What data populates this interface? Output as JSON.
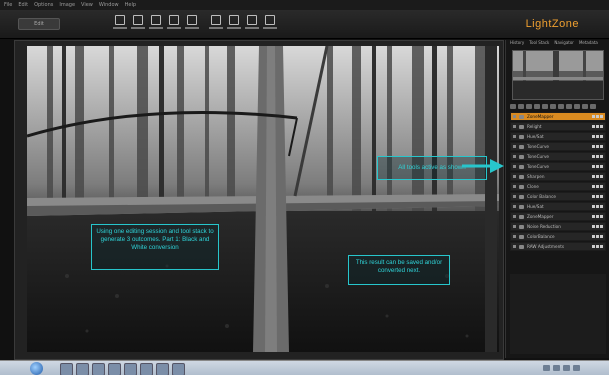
{
  "app": {
    "brand": "LightZone",
    "logo_label": "Edit"
  },
  "menu": [
    "File",
    "Edit",
    "Options",
    "Image",
    "View",
    "Window",
    "Help"
  ],
  "toolbar": {
    "buttons": [
      "",
      "",
      "",
      "",
      "",
      "",
      "",
      "",
      ""
    ]
  },
  "panel": {
    "tabs": [
      "History",
      "Tool Stack",
      "Navigator",
      "Metadata"
    ],
    "tools": [
      {
        "label": "ZoneMapper",
        "active": true
      },
      {
        "label": "Relight",
        "active": false
      },
      {
        "label": "Hue/Sat",
        "active": false
      },
      {
        "label": "ToneCurve",
        "active": false
      },
      {
        "label": "ToneCurve",
        "active": false
      },
      {
        "label": "ToneCurve",
        "active": false
      },
      {
        "label": "Sharpen",
        "active": false
      },
      {
        "label": "Clone",
        "active": false
      },
      {
        "label": "Color Balance",
        "active": false
      },
      {
        "label": "Hue/Sat",
        "active": false
      },
      {
        "label": "ZoneMapper",
        "active": false
      },
      {
        "label": "Noise Reduction",
        "active": false
      },
      {
        "label": "ColorBalance",
        "active": false
      },
      {
        "label": "RAW Adjustments",
        "active": false
      }
    ]
  },
  "callouts": {
    "left": "Using one editing session and tool stack to generate 3 outcomes. Part 1: Black and White conversion",
    "right": "All tools active as shown",
    "bottom": "This result can be saved and/or converted next."
  },
  "colors": {
    "accent": "#27c6cc",
    "active_tool": "#d98a20",
    "brand": "#f0a030"
  }
}
